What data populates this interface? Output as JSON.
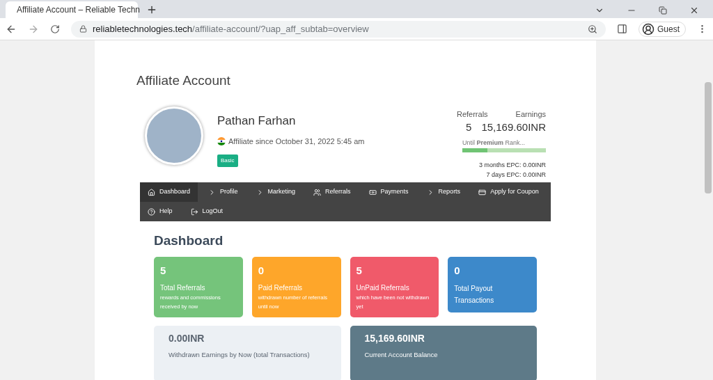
{
  "browser": {
    "tab_title": "Affiliate Account – Reliable Techn",
    "url_host": "reliabletechnologies.tech",
    "url_path": "/affiliate-account/?uap_aff_subtab=overview",
    "profile": "Guest"
  },
  "page_title": "Affiliate Account",
  "profile": {
    "name": "Pathan Farhan",
    "since": "Affiliate since October 31, 2022 5:45 am",
    "rank_badge": "Basic"
  },
  "stats": {
    "referrals_label": "Referrals",
    "referrals": "5",
    "earnings_label": "Earnings",
    "earnings": "15,169.60INR",
    "rank_progress": {
      "text": "Until **Premium** Rank...",
      "level": 0.3
    },
    "epc_3m": "3 months EPC: 0.00INR",
    "epc_7d": "7 days EPC: 0.00INR"
  },
  "nav": [
    {
      "label": "Dashboard",
      "kind": "home",
      "selected": true
    },
    {
      "label": "Profile",
      "kind": "chevron",
      "selected": false
    },
    {
      "label": "Marketing",
      "kind": "chevron",
      "selected": false
    },
    {
      "label": "Referrals",
      "kind": "users",
      "selected": false
    },
    {
      "label": "Payments",
      "kind": "money",
      "selected": false
    },
    {
      "label": "Reports",
      "kind": "chevron",
      "selected": false
    },
    {
      "label": "Apply for Coupon",
      "kind": "list",
      "selected": false
    },
    {
      "label": "Help",
      "kind": "help",
      "selected": false
    },
    {
      "label": "LogOut",
      "kind": "logout",
      "selected": false
    }
  ],
  "dashboard": {
    "heading": "Dashboard",
    "cards": [
      {
        "value": "5",
        "title": "Total Referrals",
        "subtitle": "rewards and commissions received by now",
        "color": "#75c47b"
      },
      {
        "value": "0",
        "title": "Paid Referrals",
        "subtitle": "withdrawn number of referrals until now",
        "color": "#fea62a"
      },
      {
        "value": "5",
        "title": "UnPaid Referrals",
        "subtitle": "which have been not withdrawn yet",
        "color": "#f05a6a"
      },
      {
        "value": "0",
        "title": "Total Payout Transactions",
        "color": "#3d89ca"
      }
    ],
    "totals": [
      {
        "value": "0.00INR",
        "label": "Withdrawn Earnings by Now (total Transactions)",
        "kind": "light"
      },
      {
        "value": "15,169.60INR",
        "label": "Current Account Balance",
        "kind": "dark"
      }
    ]
  }
}
